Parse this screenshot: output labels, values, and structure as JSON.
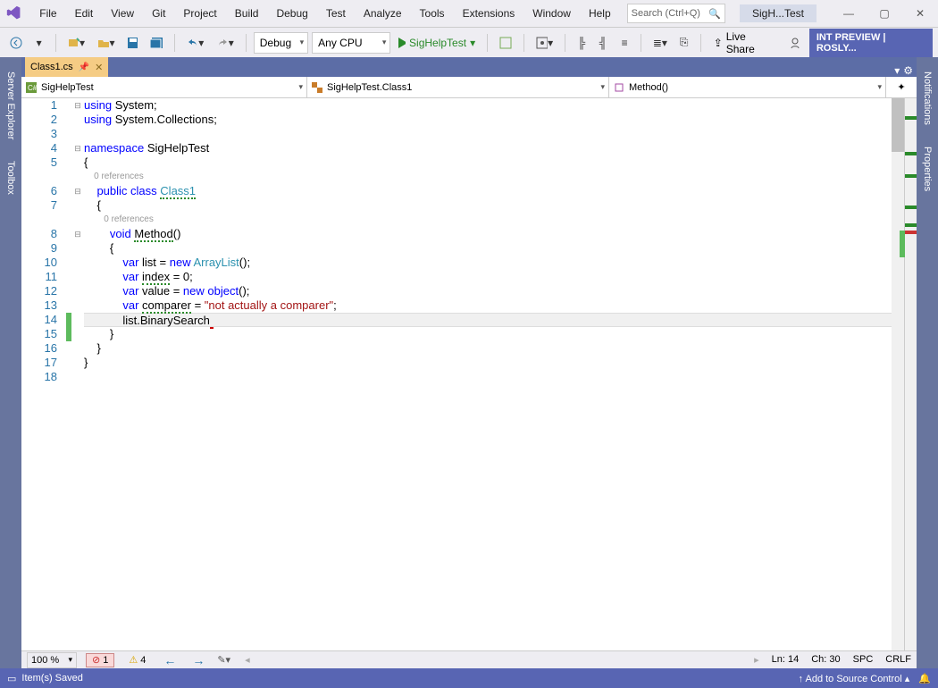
{
  "titlebar": {
    "menu": [
      "File",
      "Edit",
      "View",
      "Git",
      "Project",
      "Build",
      "Debug",
      "Test",
      "Analyze",
      "Tools",
      "Extensions",
      "Window",
      "Help"
    ],
    "search_placeholder": "Search (Ctrl+Q)",
    "title": "SigH...Test"
  },
  "toolbar": {
    "config": "Debug",
    "platform": "Any CPU",
    "start": "SigHelpTest",
    "liveshare": "Live Share",
    "preview": "INT PREVIEW | ROSLY..."
  },
  "left_rail": [
    "Server Explorer",
    "Toolbox"
  ],
  "right_rail": [
    "Notifications",
    "Properties"
  ],
  "tab": {
    "name": "Class1.cs"
  },
  "navbar": {
    "project": "SigHelpTest",
    "class": "SigHelpTest.Class1",
    "member": "Method()"
  },
  "code": {
    "lines": [
      {
        "n": 1,
        "html": "<span class='kw'>using</span> System;"
      },
      {
        "n": 2,
        "html": "<span class='kw'>using</span> System.Collections;"
      },
      {
        "n": 3,
        "html": ""
      },
      {
        "n": 4,
        "html": "<span class='kw'>namespace</span> SigHelpTest"
      },
      {
        "n": 5,
        "html": "{"
      },
      {
        "n": 0,
        "codelens": "    0 references"
      },
      {
        "n": 6,
        "html": "    <span class='kw'>public</span> <span class='kw'>class</span> <span class='cls squig'>Class1</span>"
      },
      {
        "n": 7,
        "html": "    {"
      },
      {
        "n": 0,
        "codelens": "        0 references"
      },
      {
        "n": 8,
        "html": "        <span class='kw'>void</span> <span class='squig'>Method</span>()"
      },
      {
        "n": 9,
        "html": "        {"
      },
      {
        "n": 10,
        "html": "            <span class='kw'>var</span> list = <span class='kw'>new</span> <span class='typ'>ArrayList</span>();"
      },
      {
        "n": 11,
        "html": "            <span class='kw'>var</span> <span class='squig'>index</span> = 0;"
      },
      {
        "n": 12,
        "html": "            <span class='kw'>var</span> value = <span class='kw'>new</span> <span class='kw'>object</span>();"
      },
      {
        "n": 13,
        "html": "            <span class='kw'>var</span> <span class='squig'>comparer</span> = <span class='str'>\"not actually a comparer\"</span>;"
      },
      {
        "n": 14,
        "hl": true,
        "html": "            list.BinarySearch<span class='squig-err'> </span>"
      },
      {
        "n": 15,
        "html": "        }"
      },
      {
        "n": 16,
        "html": "    }"
      },
      {
        "n": 17,
        "html": "}"
      },
      {
        "n": 18,
        "html": ""
      }
    ],
    "changed_lines": [
      14,
      15
    ]
  },
  "editor_status": {
    "zoom": "100 %",
    "errors": "1",
    "warnings": "4",
    "ln": "Ln: 14",
    "ch": "Ch: 30",
    "ws": "SPC",
    "eol": "CRLF"
  },
  "statusbar": {
    "left": "Item(s) Saved",
    "source_control": "Add to Source Control"
  }
}
